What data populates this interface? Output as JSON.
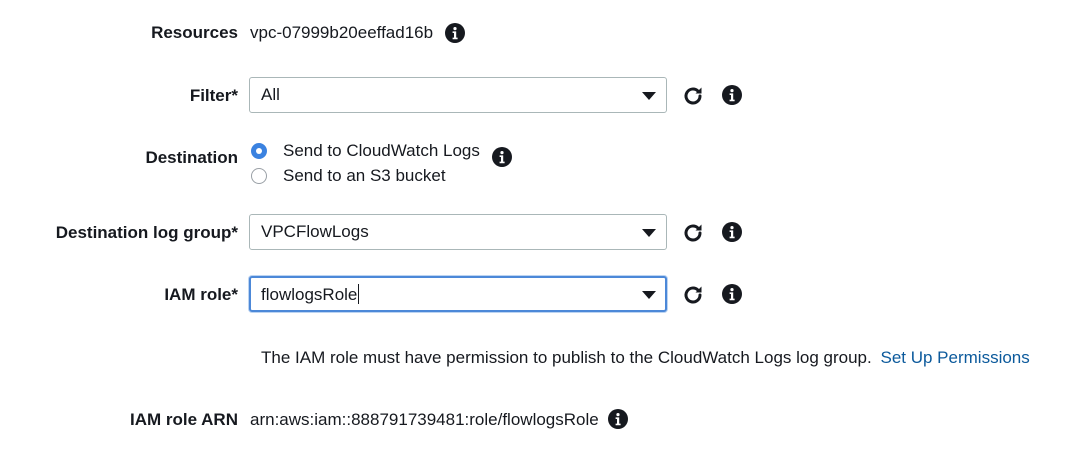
{
  "resources": {
    "label": "Resources",
    "value": "vpc-07999b20eeffad16b",
    "info_icon": "info-icon"
  },
  "filter": {
    "label": "Filter*",
    "value": "All",
    "caret_icon": "chevron-down-icon",
    "refresh_icon": "refresh-icon",
    "info_icon": "info-icon"
  },
  "destination": {
    "label": "Destination",
    "options": [
      {
        "label": "Send to CloudWatch Logs",
        "selected": true
      },
      {
        "label": "Send to an S3 bucket",
        "selected": false
      }
    ],
    "info_icon": "info-icon"
  },
  "log_group": {
    "label": "Destination log group*",
    "value": "VPCFlowLogs",
    "caret_icon": "chevron-down-icon",
    "refresh_icon": "refresh-icon",
    "info_icon": "info-icon"
  },
  "iam_role": {
    "label": "IAM role*",
    "value": "flowlogsRole",
    "caret_icon": "chevron-down-icon",
    "refresh_icon": "refresh-icon",
    "info_icon": "info-icon"
  },
  "help": {
    "text": "The IAM role must have permission to publish to the CloudWatch Logs log group.",
    "link": "Set Up Permissions"
  },
  "iam_role_arn": {
    "label": "IAM role ARN",
    "value": "arn:aws:iam::888791739481:role/flowlogsRole",
    "info_icon": "info-icon"
  },
  "colors": {
    "accent": "#3b82e0",
    "link": "#0c5a9c",
    "focus_border": "#4c88d8",
    "text": "#16191f"
  }
}
